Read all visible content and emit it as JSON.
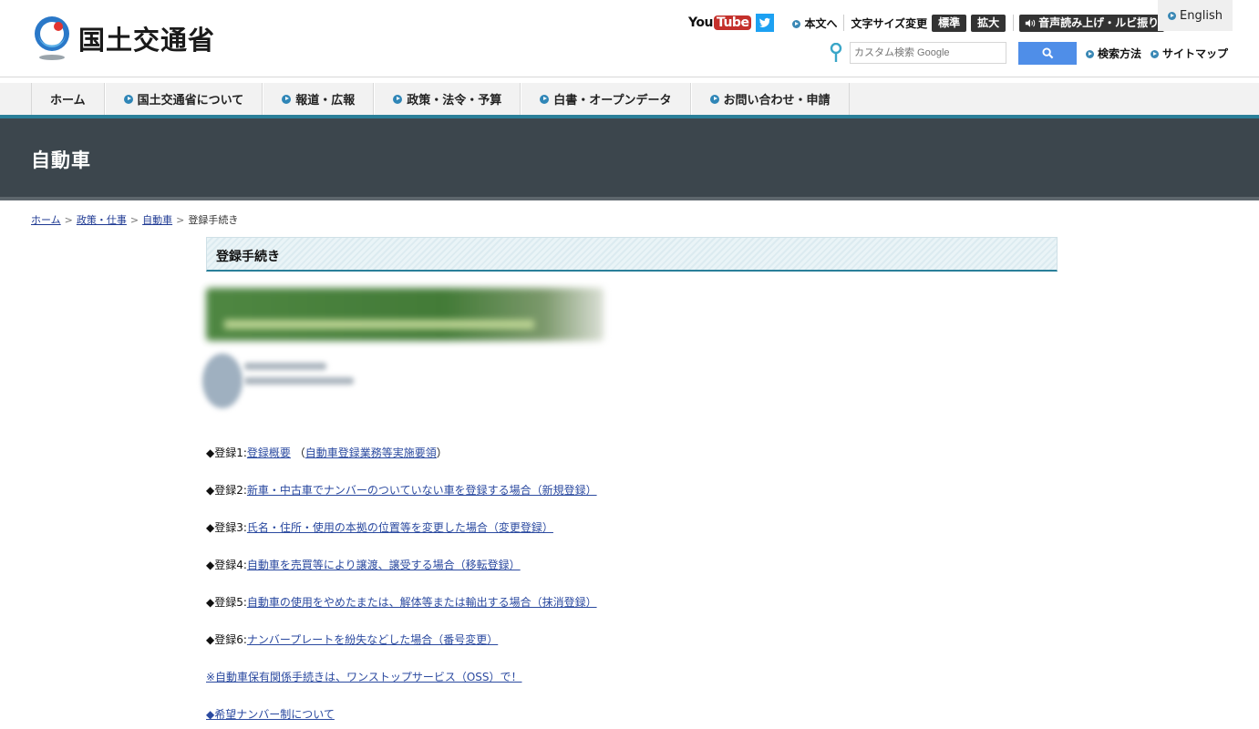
{
  "header": {
    "logo_text": "国土交通省",
    "youtube_you": "You",
    "youtube_tube": "Tube",
    "honbun": "本文へ",
    "moji_size": "文字サイズ変更",
    "size_standard": "標準",
    "size_large": "拡大",
    "voice": "音声読み上げ・ルビ振り",
    "english": "English",
    "search_placeholder": "カスタム検索 Google",
    "search_help": "検索方法",
    "sitemap": "サイトマップ"
  },
  "nav": {
    "items": [
      {
        "label": "ホーム"
      },
      {
        "label": "国土交通省について"
      },
      {
        "label": "報道・広報"
      },
      {
        "label": "政策・法令・予算"
      },
      {
        "label": "白書・オープンデータ"
      },
      {
        "label": "お問い合わせ・申請"
      }
    ]
  },
  "banner": {
    "title": "自動車"
  },
  "breadcrumb": {
    "items": [
      "ホーム",
      "政策・仕事",
      "自動車"
    ],
    "current": "登録手続き",
    "sep": ">"
  },
  "section": {
    "title": "登録手続き"
  },
  "list": {
    "items": [
      {
        "prefix": "◆登録1:",
        "link": "登録概要",
        "extra_open": "（",
        "extra_link": "自動車登録業務等実施要領",
        "extra_close": "）"
      },
      {
        "prefix": "◆登録2:",
        "link": "新車・中古車でナンバーのついていない車を登録する場合（新規登録）"
      },
      {
        "prefix": "◆登録3:",
        "link": "氏名・住所・使用の本拠の位置等を変更した場合（変更登録）"
      },
      {
        "prefix": "◆登録4:",
        "link": "自動車を売買等により譲渡、譲受する場合（移転登録）"
      },
      {
        "prefix": "◆登録5:",
        "link": "自動車の使用をやめたまたは、解体等または輸出する場合（抹消登録）"
      },
      {
        "prefix": "◆登録6:",
        "link": "ナンバープレートを紛失などした場合（番号変更）"
      }
    ],
    "oss_link": "※自動車保有関係手続きは、ワンストップサービス（OSS）で！",
    "kibou_link": "◆希望ナンバー制について"
  },
  "colors": {
    "banner_bg": "#3c464d",
    "accent_teal": "#2a7f99",
    "search_blue": "#4f8ee8",
    "link": "#2b4aa0"
  }
}
